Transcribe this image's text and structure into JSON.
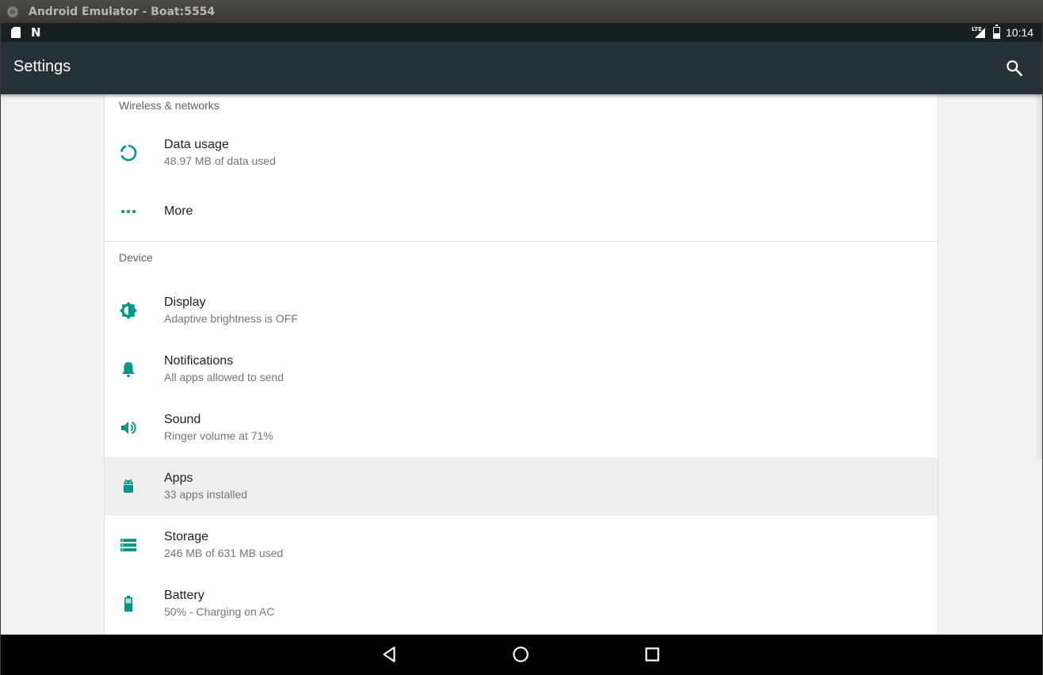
{
  "window": {
    "title": "Android Emulator - Boat:5554"
  },
  "statusbar": {
    "time": "10:14",
    "network": "LTE"
  },
  "appbar": {
    "title": "Settings"
  },
  "colors": {
    "accent": "#009688",
    "appbar": "#263238",
    "statusbar": "#192024"
  },
  "sections": {
    "wireless": {
      "header": "Wireless & networks",
      "items": [
        {
          "label": "Data usage",
          "summary": "48.97 MB of data used",
          "icon": "data-usage-icon"
        },
        {
          "label": "More",
          "icon": "more-horiz-icon"
        }
      ]
    },
    "device": {
      "header": "Device",
      "items": [
        {
          "label": "Display",
          "summary": "Adaptive brightness is OFF",
          "icon": "brightness-icon"
        },
        {
          "label": "Notifications",
          "summary": "All apps allowed to send",
          "icon": "bell-icon"
        },
        {
          "label": "Sound",
          "summary": "Ringer volume at 71%",
          "icon": "volume-icon"
        },
        {
          "label": "Apps",
          "summary": "33 apps installed",
          "icon": "android-icon"
        },
        {
          "label": "Storage",
          "summary": "246 MB of 631 MB used",
          "icon": "storage-icon"
        },
        {
          "label": "Battery",
          "summary": "50% - Charging on AC",
          "icon": "battery-icon"
        }
      ]
    }
  },
  "navbar": {
    "buttons": [
      "back-icon",
      "home-icon",
      "recents-icon"
    ]
  }
}
